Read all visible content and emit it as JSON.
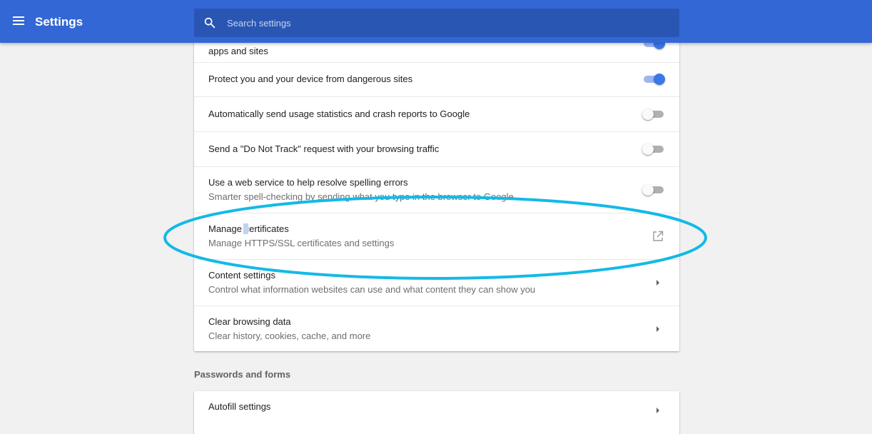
{
  "header": {
    "app_title": "Settings",
    "menu_icon": "hamburger-menu-icon",
    "search_placeholder": "Search settings"
  },
  "colors": {
    "header_bg": "#3367d6",
    "search_bg": "#2a56b3",
    "toggle_on": "#3b78e7",
    "highlight_ellipse": "#14b9e6"
  },
  "privacy_rows": [
    {
      "label": "apps and sites",
      "control": "toggle",
      "state": "on"
    },
    {
      "label": "Protect you and your device from dangerous sites",
      "control": "toggle",
      "state": "on"
    },
    {
      "label": "Automatically send usage statistics and crash reports to Google",
      "control": "toggle",
      "state": "off"
    },
    {
      "label": "Send a \"Do Not Track\" request with your browsing traffic",
      "control": "toggle",
      "state": "off"
    },
    {
      "label": "Use a web service to help resolve spelling errors",
      "sublabel": "Smarter spell-checking by sending what you type in the browser to Google",
      "control": "toggle",
      "state": "off"
    },
    {
      "label": "Manage certificates",
      "sublabel": "Manage HTTPS/SSL certificates and settings",
      "control": "external-link-icon",
      "highlighted": true
    },
    {
      "label": "Content settings",
      "sublabel": "Control what information websites can use and what content they can show you",
      "control": "chevron-right-icon"
    },
    {
      "label": "Clear browsing data",
      "sublabel": "Clear history, cookies, cache, and more",
      "control": "chevron-right-icon"
    }
  ],
  "passwords_section": {
    "title": "Passwords and forms",
    "rows": [
      {
        "label": "Autofill settings",
        "control": "chevron-right-icon"
      }
    ]
  }
}
